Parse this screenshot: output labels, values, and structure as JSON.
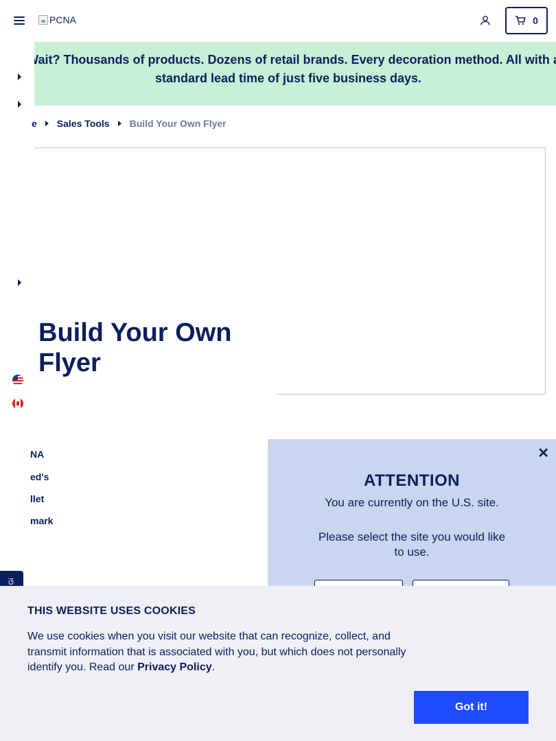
{
  "header": {
    "logo_alt": "PCNA",
    "cart_count": "0"
  },
  "promo": {
    "text": "y Wait? Thousands of products. Dozens of retail brands. Every decoration method. All with a standard lead time of just five business days."
  },
  "breadcrumb": {
    "items": [
      "e",
      "Sales Tools",
      "Build Your Own Flyer"
    ]
  },
  "hero": {
    "title": "Build Your Own Flyer"
  },
  "brands": [
    "NA",
    "ed's",
    "llet",
    "mark"
  ],
  "side_tab": {
    "label": "Gi"
  },
  "modal": {
    "title": "ATTENTION",
    "line1": "You are currently on the U.S. site.",
    "prompt": "Please select the site you would like to use."
  },
  "cookie": {
    "title": "THIS WEBSITE USES COOKIES",
    "text_before": "We use cookies when you visit our website that can recognize, collect, and transmit information that is associated with you, but which does not personally identify you. Read our ",
    "link": "Privacy Policy",
    "text_after": ".",
    "button": "Got it!"
  },
  "colors": {
    "navy": "#0a1f5c",
    "promo_bg": "#c8f0d6",
    "modal_bg": "#c8d6ef",
    "cookie_bg": "#eef0f5",
    "button_blue": "#1f4bff"
  }
}
